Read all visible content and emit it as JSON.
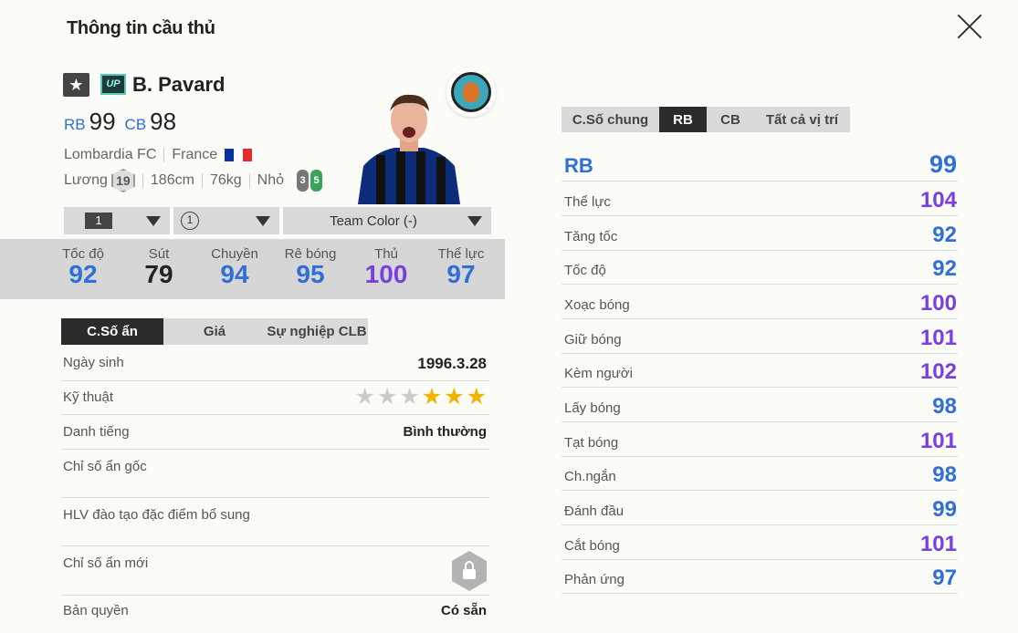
{
  "header": {
    "title": "Thông tin cầu thủ"
  },
  "player": {
    "name": "B. Pavard",
    "season_badge": "UP",
    "pos1": "RB",
    "ovr1": "99",
    "pos2": "CB",
    "ovr2": "98",
    "club": "Lombardia FC",
    "nation": "France",
    "salary_label": "Lương",
    "salary": "19",
    "height": "186cm",
    "weight": "76kg",
    "body": "Nhỏ",
    "weak_foot_left": "3",
    "weak_foot_right": "5"
  },
  "selectors": {
    "level": "1",
    "enhance": "1",
    "team_color": "Team Color (-)"
  },
  "main_stats": [
    {
      "label": "Tốc độ",
      "value": "92",
      "color": "#2f6fd6"
    },
    {
      "label": "Sút",
      "value": "79",
      "color": "#222222"
    },
    {
      "label": "Chuyền",
      "value": "94",
      "color": "#2f6fd6"
    },
    {
      "label": "Rê bóng",
      "value": "95",
      "color": "#2f6fd6"
    },
    {
      "label": "Thủ",
      "value": "100",
      "color": "#7b3fe0"
    },
    {
      "label": "Thể lực",
      "value": "97",
      "color": "#2f6fd6"
    }
  ],
  "left_tabs": [
    "C.Số ẩn",
    "Giá",
    "Sự nghiệp CLB"
  ],
  "details": {
    "birth_label": "Ngày sinh",
    "birth": "1996.3.28",
    "skill_label": "Kỹ thuật",
    "skill_stars": 3,
    "skill_max": 6,
    "rep_label": "Danh tiếng",
    "rep": "Bình thường",
    "hidden_label": "Chỉ số ẩn gốc",
    "coach_label": "HLV đào tạo đặc điểm bổ sung",
    "new_hidden_label": "Chỉ số ẩn mới",
    "license_label": "Bản quyền",
    "license": "Có sẵn"
  },
  "right_tabs": [
    "C.Số chung",
    "RB",
    "CB",
    "Tất cả vị trí"
  ],
  "position_stats": {
    "pos_label": "RB",
    "pos_value": "99",
    "rows": [
      {
        "label": "Thể lực",
        "value": "104",
        "color": "#7b3fe0"
      },
      {
        "label": "Tăng tốc",
        "value": "92",
        "color": "#2f6fd6"
      },
      {
        "label": "Tốc độ",
        "value": "92",
        "color": "#2f6fd6"
      },
      {
        "label": "Xoạc bóng",
        "value": "100",
        "color": "#7b3fe0"
      },
      {
        "label": "Giữ bóng",
        "value": "101",
        "color": "#7b3fe0"
      },
      {
        "label": "Kèm người",
        "value": "102",
        "color": "#7b3fe0"
      },
      {
        "label": "Lấy bóng",
        "value": "98",
        "color": "#2f6fd6"
      },
      {
        "label": "Tạt bóng",
        "value": "101",
        "color": "#7b3fe0"
      },
      {
        "label": "Ch.ngắn",
        "value": "98",
        "color": "#2f6fd6"
      },
      {
        "label": "Đánh đầu",
        "value": "99",
        "color": "#2f6fd6"
      },
      {
        "label": "Cắt bóng",
        "value": "101",
        "color": "#7b3fe0"
      },
      {
        "label": "Phản ứng",
        "value": "97",
        "color": "#2f6fd6"
      }
    ]
  }
}
